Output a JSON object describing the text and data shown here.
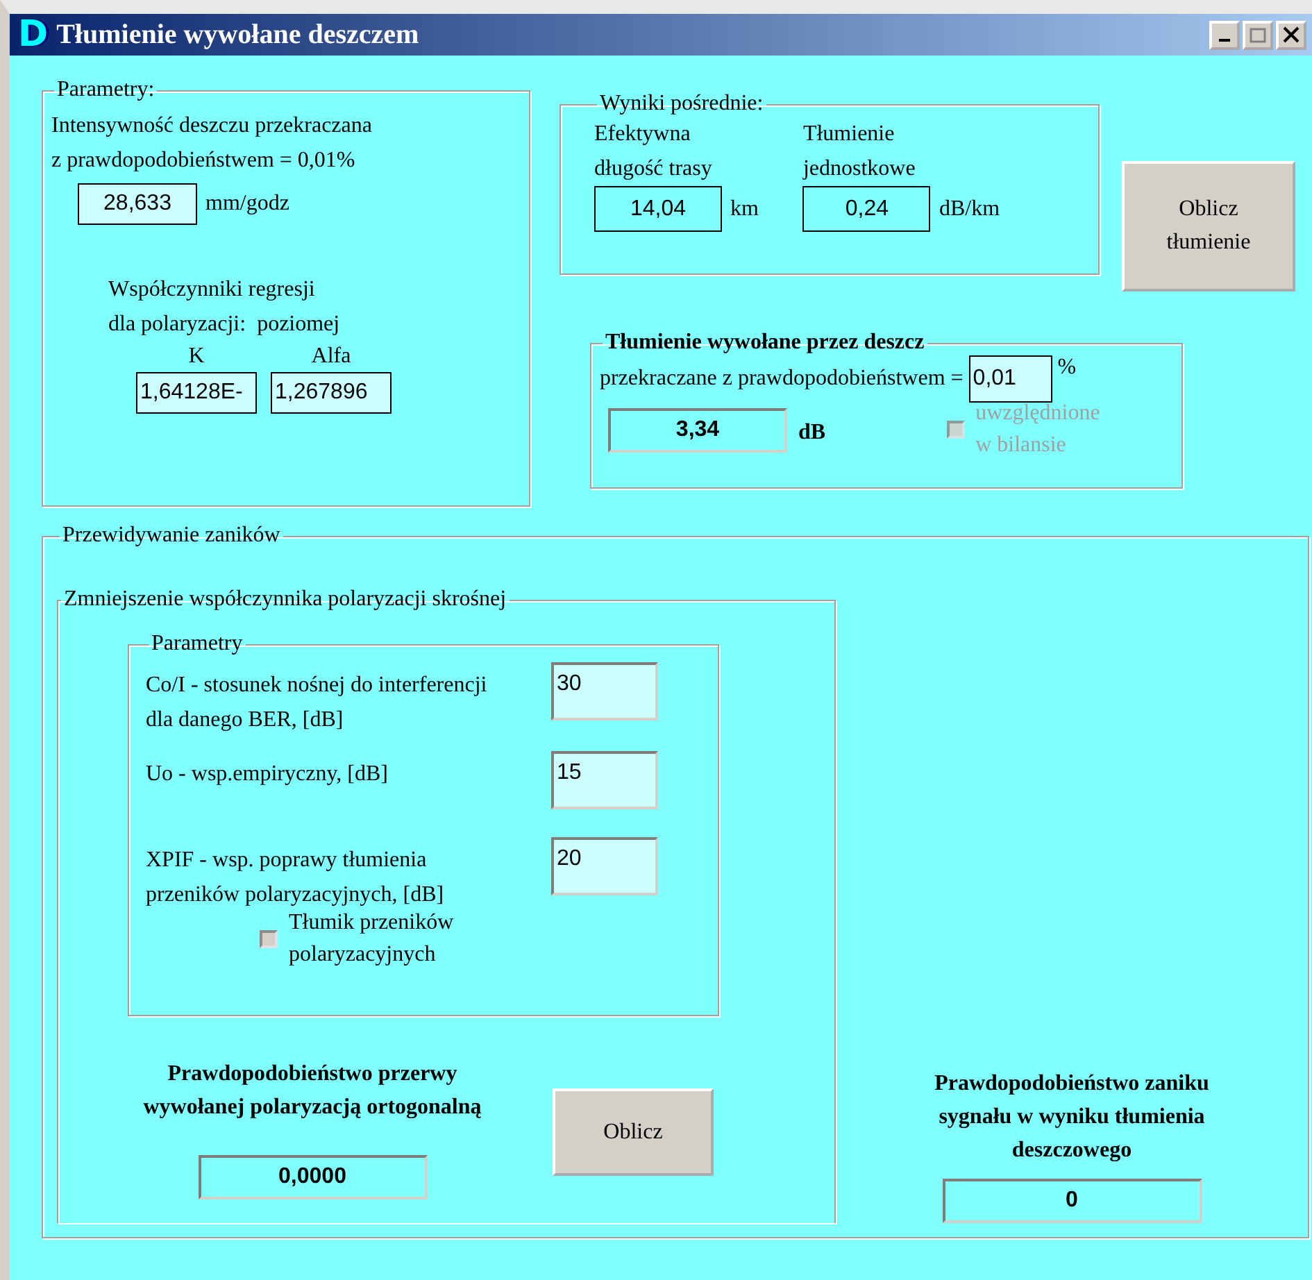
{
  "window": {
    "title": "Tłumienie wywołane deszczem",
    "logo": "D"
  },
  "parameters": {
    "title": "Parametry:",
    "intensity_lines": [
      "Intensywność deszczu przekraczana",
      "z prawdopodobieństwem = 0,01%"
    ],
    "intensity": {
      "value": "28,633",
      "unit": "mm/godz"
    },
    "regression_lines": [
      "Współczynniki regresji",
      "dla polaryzacji:  poziomej"
    ],
    "coefficients": [
      {
        "label": "K",
        "value": "1,64128E-"
      },
      {
        "label": "Alfa",
        "value": "1,267896"
      }
    ]
  },
  "intermediate": {
    "title": "Wyniki pośrednie:",
    "items": [
      {
        "label_lines": [
          "Efektywna",
          "długość trasy"
        ],
        "value": "14,04",
        "unit": "km"
      },
      {
        "label_lines": [
          "Tłumienie",
          "jednostkowe"
        ],
        "value": "0,24",
        "unit": "dB/km"
      }
    ]
  },
  "compute_button": {
    "label_lines": [
      "Oblicz",
      "tłumienie"
    ]
  },
  "rain_attenuation": {
    "title": "Tłumienie wywołane przez deszcz",
    "probability_label": "przekraczane z prawdopodobieństwem =",
    "probability": "0,01",
    "percent": "%",
    "value": "3,34",
    "unit": "dB",
    "include": {
      "label_lines": [
        "uwzględnione",
        "w bilansie"
      ],
      "checked": false,
      "disabled": true
    }
  },
  "fading": {
    "title": "Przewidywanie zaników",
    "xpd": {
      "title": "Zmniejszenie współczynnika polaryzacji skrośnej",
      "params_title": "Parametry",
      "params": [
        {
          "label": "Co/I - stosunek nośnej do interferencji dla danego BER, [dB]",
          "value": "30"
        },
        {
          "label": "Uo - wsp.empiryczny, [dB]",
          "value": "15"
        },
        {
          "label": "XPIF - wsp. poprawy tłumienia przeników polaryzacyjnych, [dB]",
          "value": "20"
        }
      ],
      "attenuator": {
        "label_lines": [
          "Tłumik przeników",
          "polaryzacyjnych"
        ],
        "checked": false,
        "disabled": false
      },
      "result_label_lines": [
        "Prawdopodobieństwo przerwy",
        "wywołanej polaryzacją ortogonalną"
      ],
      "result": "0,0000",
      "button": "Oblicz"
    },
    "rain_outage": {
      "label_lines": [
        "Prawdopodobieństwo zaniku",
        "sygnału w wyniku tłumienia",
        "deszczowego"
      ],
      "value": "0"
    }
  }
}
